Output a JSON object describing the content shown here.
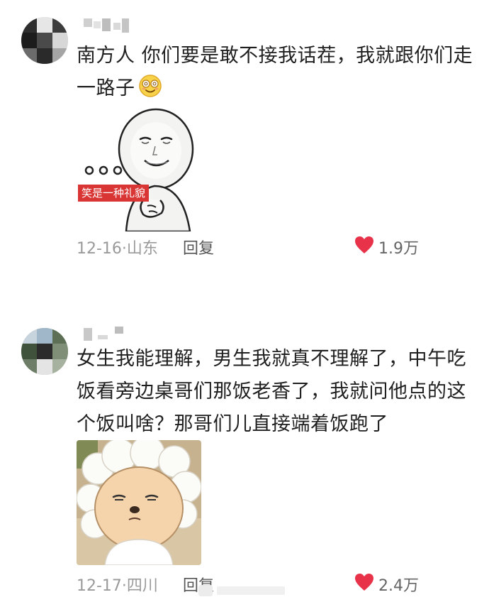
{
  "comments": [
    {
      "text_line1": "南方人 你们要是敢不接我话茬，我就跟你们走",
      "text_line2": "一路子",
      "emoji": "dizzy-smile-emoji",
      "sticker_caption": "笑是一种礼貌",
      "sticker": "smiling-face-meme",
      "date_location": "12-16·山东",
      "reply_label": "回复",
      "like_count": "1.9万"
    },
    {
      "text_line1": "女生我能理解，男生我就真不理解了，中午吃",
      "text_line2": "饭看旁边桌哥们那饭老香了，我就问他点的这",
      "text_line3": "个饭叫啥？那哥们儿直接端着饭跑了",
      "sticker": "sheep-cartoon-meme",
      "date_location": "12-17·四川",
      "reply_label": "回复",
      "like_count": "2.4万"
    }
  ],
  "colors": {
    "like_heart": "#e8324a",
    "meta_text": "#9a9a9a",
    "body_text": "#1f1f1f"
  }
}
